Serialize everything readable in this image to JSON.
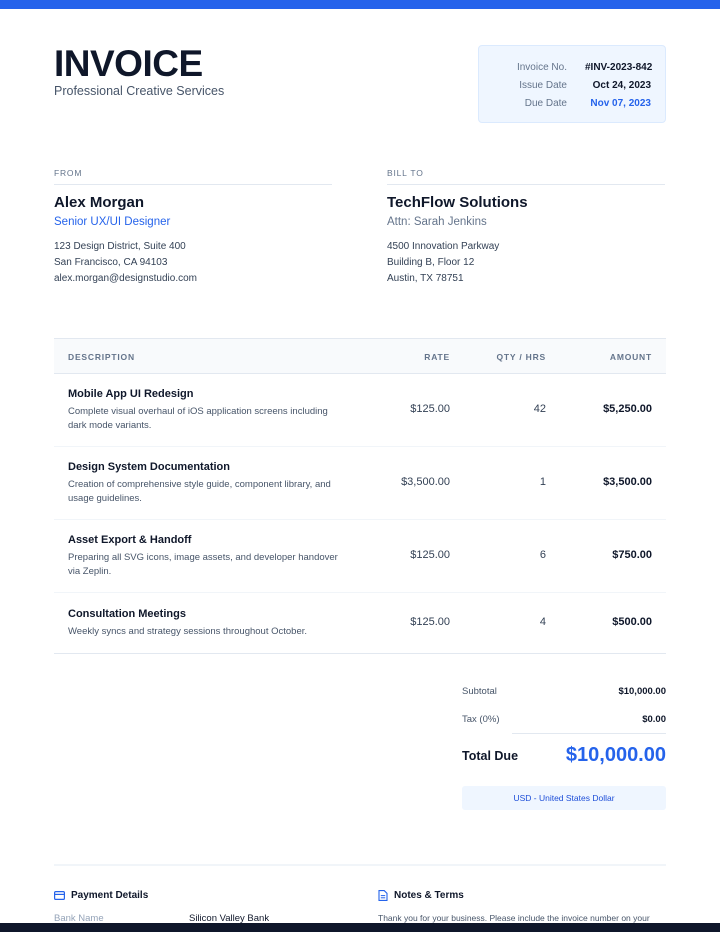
{
  "header": {
    "title": "INVOICE",
    "subtitle": "Professional Creative Services"
  },
  "meta": {
    "invoice_no_label": "Invoice No.",
    "invoice_no": "#INV-2023-842",
    "issue_date_label": "Issue Date",
    "issue_date": "Oct 24, 2023",
    "due_date_label": "Due Date",
    "due_date": "Nov 07, 2023"
  },
  "from": {
    "caption": "FROM",
    "name": "Alex Morgan",
    "role": "Senior UX/UI Designer",
    "address": [
      "123 Design District, Suite 400",
      "San Francisco, CA 94103",
      "alex.morgan@designstudio.com"
    ]
  },
  "bill_to": {
    "caption": "BILL TO",
    "name": "TechFlow Solutions",
    "attn": "Attn: Sarah Jenkins",
    "address": [
      "4500 Innovation Parkway",
      "Building B, Floor 12",
      "Austin, TX 78751"
    ]
  },
  "table": {
    "headers": {
      "description": "DESCRIPTION",
      "rate": "RATE",
      "qty": "QTY / HRS",
      "amount": "AMOUNT"
    },
    "rows": [
      {
        "title": "Mobile App UI Redesign",
        "desc": "Complete visual overhaul of iOS application screens including dark mode variants.",
        "rate": "$125.00",
        "qty": "42",
        "amount": "$5,250.00"
      },
      {
        "title": "Design System Documentation",
        "desc": "Creation of comprehensive style guide, component library, and usage guidelines.",
        "rate": "$3,500.00",
        "qty": "1",
        "amount": "$3,500.00"
      },
      {
        "title": "Asset Export & Handoff",
        "desc": "Preparing all SVG icons, image assets, and developer handover via Zeplin.",
        "rate": "$125.00",
        "qty": "6",
        "amount": "$750.00"
      },
      {
        "title": "Consultation Meetings",
        "desc": "Weekly syncs and strategy sessions throughout October.",
        "rate": "$125.00",
        "qty": "4",
        "amount": "$500.00"
      }
    ]
  },
  "totals": {
    "subtotal_label": "Subtotal",
    "subtotal": "$10,000.00",
    "tax_label": "Tax (0%)",
    "tax": "$0.00",
    "total_label": "Total Due",
    "total": "$10,000.00",
    "currency": "USD - United States Dollar"
  },
  "footer": {
    "payment_title": "Payment Details",
    "bank_label": "Bank Name",
    "bank_value": "Silicon Valley Bank",
    "notes_title": "Notes & Terms",
    "notes_text": "Thank you for your business. Please include the invoice number on your"
  },
  "colors": {
    "accent": "#2563eb",
    "text": "#0f172a",
    "muted": "#64748b"
  }
}
